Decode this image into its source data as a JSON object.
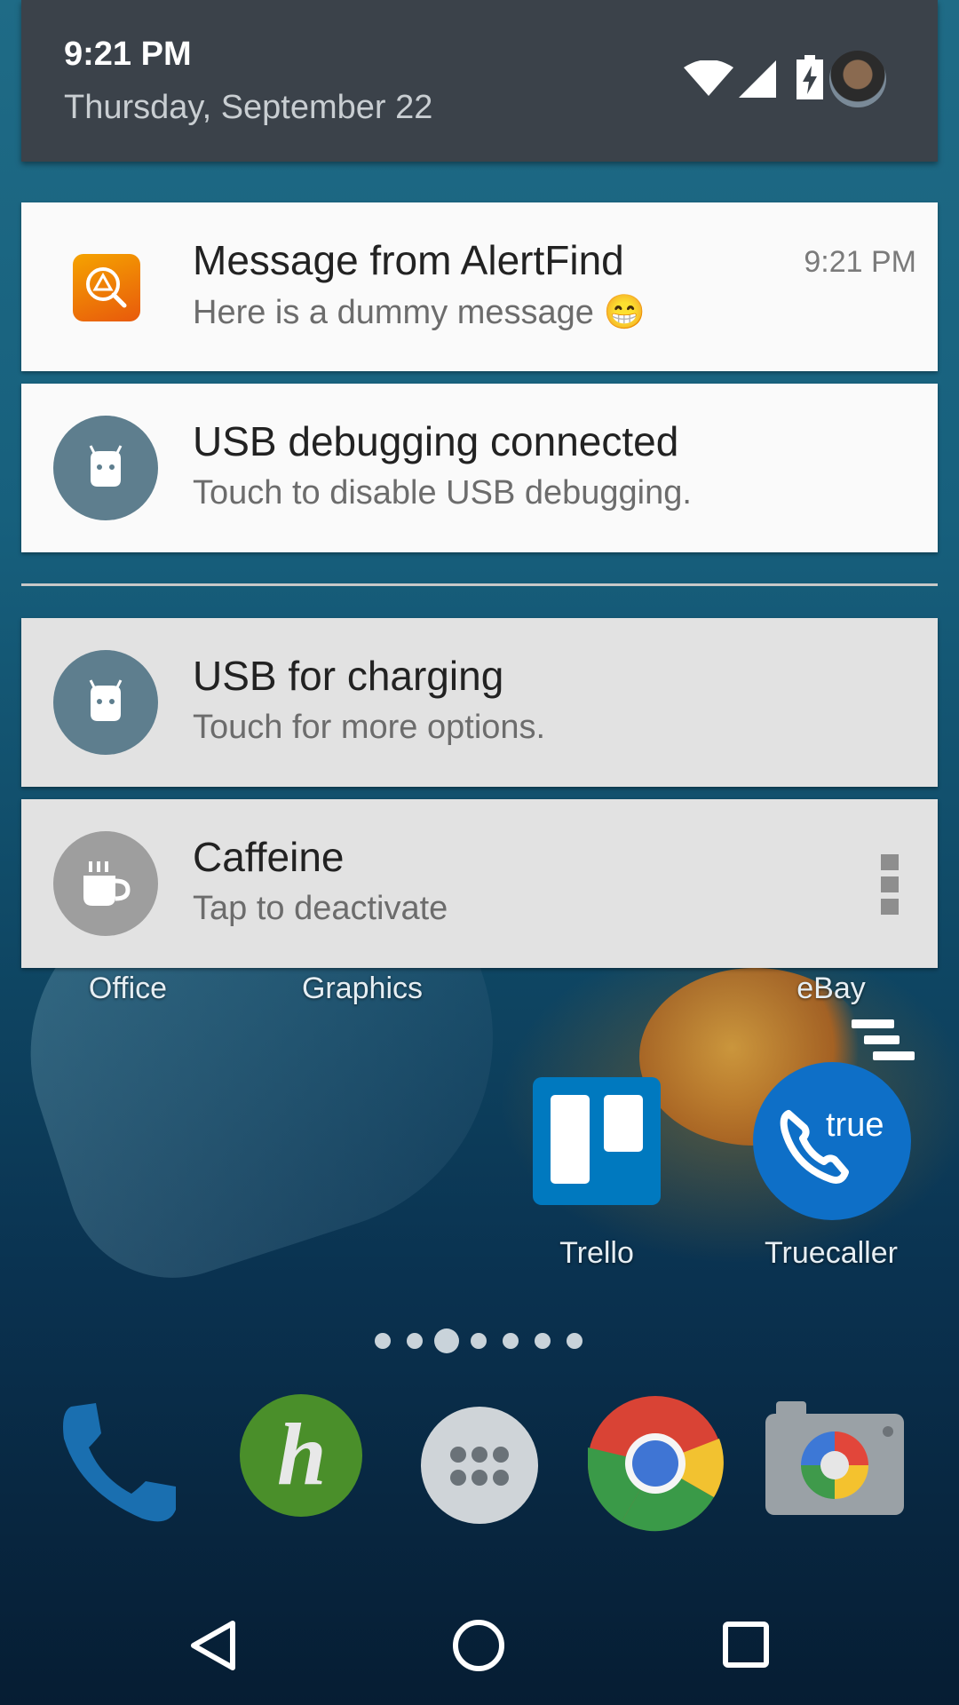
{
  "header": {
    "time": "9:21 PM",
    "date": "Thursday, September 22",
    "status_icons": [
      "wifi-icon",
      "cell-signal-icon",
      "battery-charging-icon"
    ],
    "avatar": "user-avatar"
  },
  "notifications": [
    {
      "app": "AlertFind",
      "title": "Message from AlertFind",
      "text": "Here is a dummy message 😁",
      "time": "9:21 PM",
      "icon": "alertfind-icon",
      "style": "white"
    },
    {
      "title": "USB debugging connected",
      "text": "Touch to disable USB debugging.",
      "icon": "android-icon",
      "style": "white"
    },
    {
      "title": "USB for charging",
      "text": "Touch for more options.",
      "icon": "android-icon",
      "style": "gray"
    },
    {
      "title": "Caffeine",
      "text": "Tap to deactivate",
      "icon": "coffee-cup-icon",
      "style": "gray",
      "has_menu": true
    }
  ],
  "home": {
    "labels": {
      "office": "Office",
      "graphics": "Graphics",
      "ebay": "eBay",
      "trello": "Trello",
      "truecaller": "Truecaller",
      "truecaller_badge": "true"
    },
    "page_indicator": {
      "pages": 7,
      "current": 3
    },
    "dock": [
      "phone-icon",
      "hike-icon",
      "app-drawer-icon",
      "chrome-icon",
      "camera-icon"
    ]
  },
  "navbar": [
    "back-icon",
    "home-icon",
    "recents-icon"
  ],
  "colors": {
    "header_bg": "#3b424a",
    "card_white": "#fafafa",
    "card_gray": "#e2e2e2",
    "android_icon_bg": "#5e7e8e",
    "caffeine_icon_bg": "#9e9e9e",
    "alertfind_orange": "#f08a00"
  }
}
